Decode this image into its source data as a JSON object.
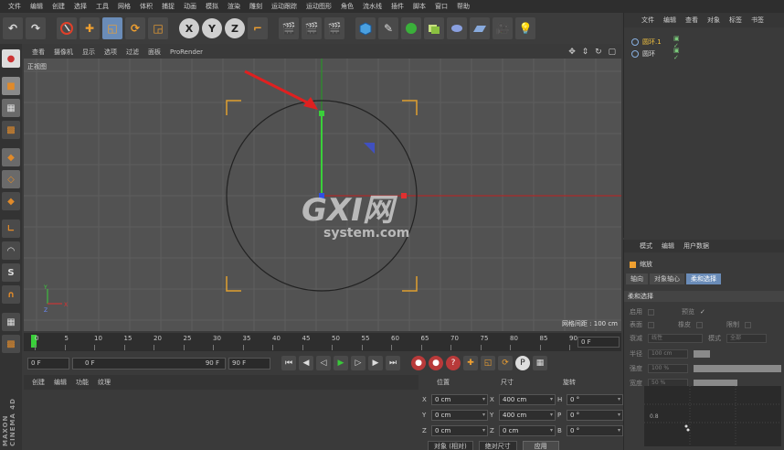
{
  "menubar": [
    "文件",
    "编辑",
    "创建",
    "选择",
    "工具",
    "网格",
    "体积",
    "捕捉",
    "动画",
    "模拟",
    "渲染",
    "雕刻",
    "运动跟踪",
    "运动图形",
    "角色",
    "流水线",
    "插件",
    "脚本",
    "窗口",
    "帮助"
  ],
  "toolbar": {
    "undo": "↶",
    "redo": "↷",
    "axis_x": "X",
    "axis_y": "Y",
    "axis_z": "Z"
  },
  "viewport": {
    "tabs": [
      "查看",
      "摄像机",
      "显示",
      "选项",
      "过滤",
      "面板",
      "ProRender"
    ],
    "view_label": "正视图",
    "grid_info": "网格间距 : 100 cm",
    "watermark_main": "GXI网",
    "watermark_sub": "system.com"
  },
  "timeline": {
    "ticks": [
      "0",
      "5",
      "10",
      "15",
      "20",
      "25",
      "30",
      "35",
      "40",
      "45",
      "50",
      "55",
      "60",
      "65",
      "70",
      "75",
      "80",
      "85",
      "90"
    ],
    "current_frame": "0 F"
  },
  "playbar": {
    "start": "0 F",
    "range_start": "0 F",
    "range_end": "90 F",
    "end": "90 F"
  },
  "material_panel": {
    "tabs": [
      "创建",
      "编辑",
      "功能",
      "纹理"
    ]
  },
  "coordinates": {
    "headers": {
      "position": "位置",
      "size": "尺寸",
      "rotation": "旋转"
    },
    "rows": [
      {
        "axis": "X",
        "pos": "0 cm",
        "size_axis": "X",
        "size": "400 cm",
        "rot_axis": "H",
        "rot": "0 °"
      },
      {
        "axis": "Y",
        "pos": "0 cm",
        "size_axis": "Y",
        "size": "400 cm",
        "rot_axis": "P",
        "rot": "0 °"
      },
      {
        "axis": "Z",
        "pos": "0 cm",
        "size_axis": "Z",
        "size": "0 cm",
        "rot_axis": "B",
        "rot": "0 °"
      }
    ],
    "mode_object": "对象 (相对)",
    "mode_size": "绝对尺寸",
    "apply": "应用"
  },
  "object_manager": {
    "tabs": [
      "文件",
      "编辑",
      "查看",
      "对象",
      "标签",
      "书签"
    ],
    "objects": [
      {
        "name": "圆环.1",
        "selected": true
      },
      {
        "name": "圆环",
        "selected": false
      }
    ]
  },
  "attributes": {
    "tabs": [
      "模式",
      "编辑",
      "用户数据"
    ],
    "title": "缩放",
    "subtabs": [
      "轴向",
      "对象轴心",
      "柔和选择"
    ],
    "active_subtab": "柔和选择",
    "section": "柔和选择",
    "rows": {
      "enable": "启用",
      "preview": "预览",
      "surface": "表面",
      "rubber": "橡皮",
      "restrict": "限制",
      "falloff": "衰减",
      "falloff_val": "线性",
      "mode": "模式",
      "mode_val": "全部",
      "radius": "半径",
      "radius_val": "100 cm",
      "strength": "强度",
      "strength_val": "100 %",
      "width": "宽度",
      "width_val": "50 %"
    },
    "graph_label": "0.8"
  },
  "brand": "MAXON CINEMA 4D"
}
